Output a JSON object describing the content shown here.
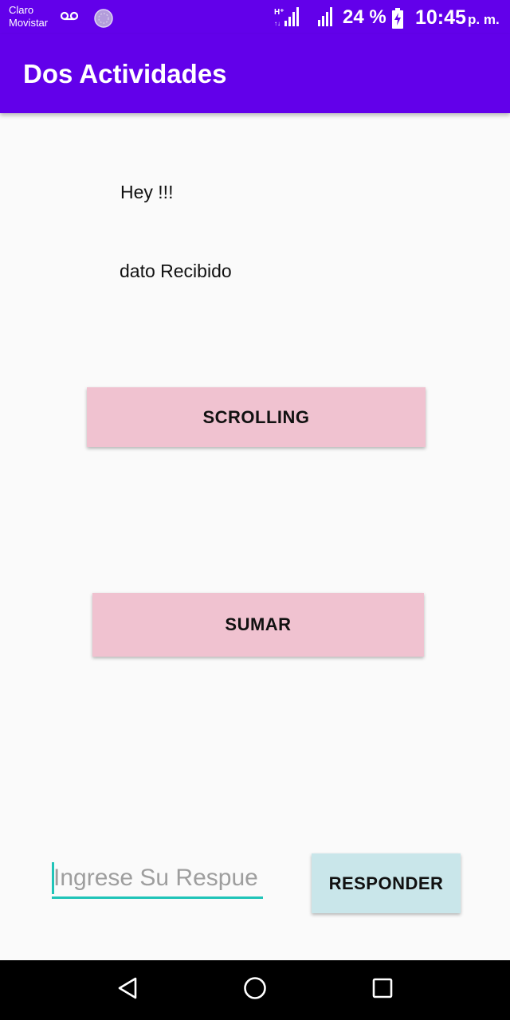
{
  "status_bar": {
    "carrier_line1": "Claro",
    "carrier_line2": "Movistar",
    "battery_percent": "24 %",
    "time": "10:45",
    "ampm": "p. m.",
    "icons": [
      "voicemail-icon",
      "sync-icon",
      "signal-hplus-icon",
      "signal-icon",
      "battery-charging-icon"
    ]
  },
  "app_bar": {
    "title": "Dos Actividades",
    "color": "#6200ea"
  },
  "content": {
    "greeting": "Hey !!!",
    "received_label": "dato Recibido",
    "scrolling_button": "SCROLLING",
    "sumar_button": "SUMAR",
    "answer_input": {
      "placeholder": "Ingrese Su Respue",
      "value": ""
    },
    "responder_button": "RESPONDER"
  },
  "nav_bar": {
    "icons": [
      "back-icon",
      "home-icon",
      "recents-icon"
    ]
  }
}
